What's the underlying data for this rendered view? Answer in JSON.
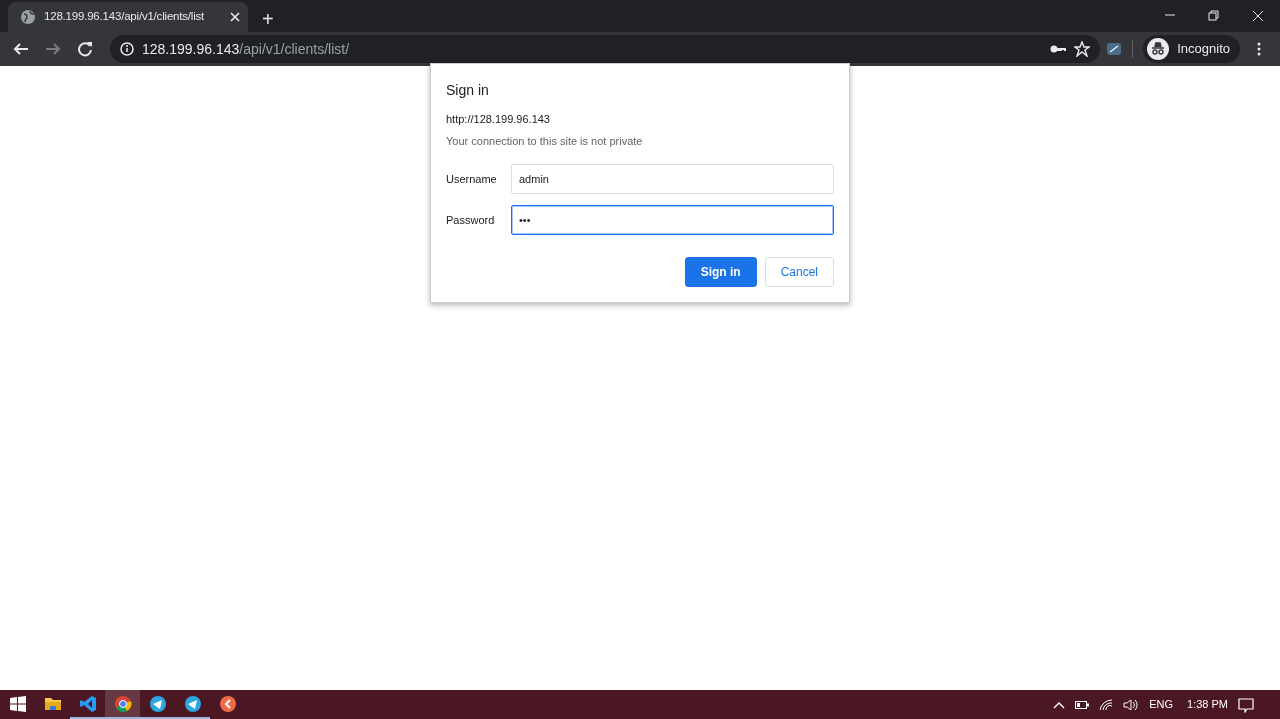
{
  "browser": {
    "tab": {
      "title": "128.199.96.143/api/v1/clients/list",
      "selected": true
    },
    "new_tab": "+",
    "address": {
      "host": "128.199.96.143",
      "path": "/api/v1/clients/list/"
    },
    "profile": "Incognito"
  },
  "dialog": {
    "title": "Sign in",
    "origin": "http://128.199.96.143",
    "notice": "Your connection to this site is not private",
    "fields": [
      {
        "label": "Username",
        "value": "admin",
        "focused": false
      },
      {
        "label": "Password",
        "value": "•••",
        "focused": true
      }
    ],
    "buttons": [
      {
        "label": "Sign in",
        "kind": "primary"
      },
      {
        "label": "Cancel",
        "kind": "secondary"
      }
    ]
  },
  "taskbar": {
    "apps": [
      {
        "kind": "folder",
        "running": false,
        "selected": false
      },
      {
        "kind": "code",
        "running": true,
        "selected": false
      },
      {
        "kind": "chrome",
        "running": true,
        "selected": true
      },
      {
        "kind": "telegram",
        "running": true,
        "selected": false
      },
      {
        "kind": "telegram2",
        "running": true,
        "selected": false
      },
      {
        "kind": "orange",
        "running": false,
        "selected": false
      }
    ],
    "language": "ENG",
    "time": "1:38 PM"
  }
}
